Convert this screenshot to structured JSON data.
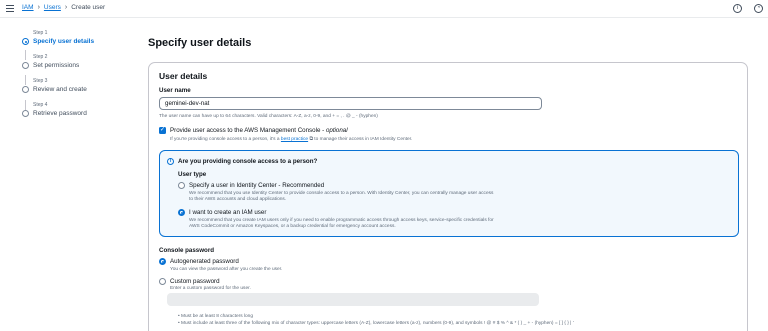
{
  "breadcrumb": {
    "items": [
      "IAM",
      "Users"
    ],
    "current": "Create user"
  },
  "top_icons": [
    "info-icon",
    "settings-icon"
  ],
  "steps": [
    {
      "num": "Step 1",
      "label": "Specify user details",
      "active": true
    },
    {
      "num": "Step 2",
      "label": "Set permissions",
      "active": false
    },
    {
      "num": "Step 3",
      "label": "Review and create",
      "active": false
    },
    {
      "num": "Step 4",
      "label": "Retrieve password",
      "active": false
    }
  ],
  "page_title": "Specify user details",
  "user_details": {
    "title": "User details",
    "username_label": "User name",
    "username_value": "geminei-dev-nat",
    "username_hint": "The user name can have up to 64 characters. Valid characters: A-Z, a-z, 0-9, and + = , . @ _ - (hyphen)",
    "console_access_label": "Provide user access to the AWS Management Console -",
    "console_access_optional": "optional",
    "console_access_hint_pre": "If you're providing console access to a person, it's a",
    "console_access_link": "best practice",
    "console_access_hint_post": "to manage their access in IAM Identity Center."
  },
  "alert": {
    "title": "Are you providing console access to a person?",
    "user_type_label": "User type",
    "option1_label": "Specify a user in Identity Center - Recommended",
    "option1_desc1": "We recommend that you use Identity Center to provide console access to a person. With Identity Center, you can centrally manage user access",
    "option1_desc2": "to their AWS accounts and cloud applications.",
    "option2_label": "I want to create an IAM user",
    "option2_desc1": "We recommend that you create IAM users only if you need to enable programmatic access through access keys, service-specific credentials for",
    "option2_desc2": "AWS CodeCommit or Amazon Keyspaces, or a backup credential for emergency account access."
  },
  "password": {
    "label": "Console password",
    "auto_label": "Autogenerated password",
    "auto_desc": "You can view the password after you create the user.",
    "custom_label": "Custom password",
    "custom_desc": "Enter a custom password for the user.",
    "rule1": "Must be at least 8 characters long",
    "rule2": "Must include at least three of the following mix of character types: uppercase letters (A-Z), lowercase letters (a-z), numbers (0-9), and symbols ! @ # $ % ^ & * ( ) _ + - (hyphen) = [ ] { } | '"
  }
}
